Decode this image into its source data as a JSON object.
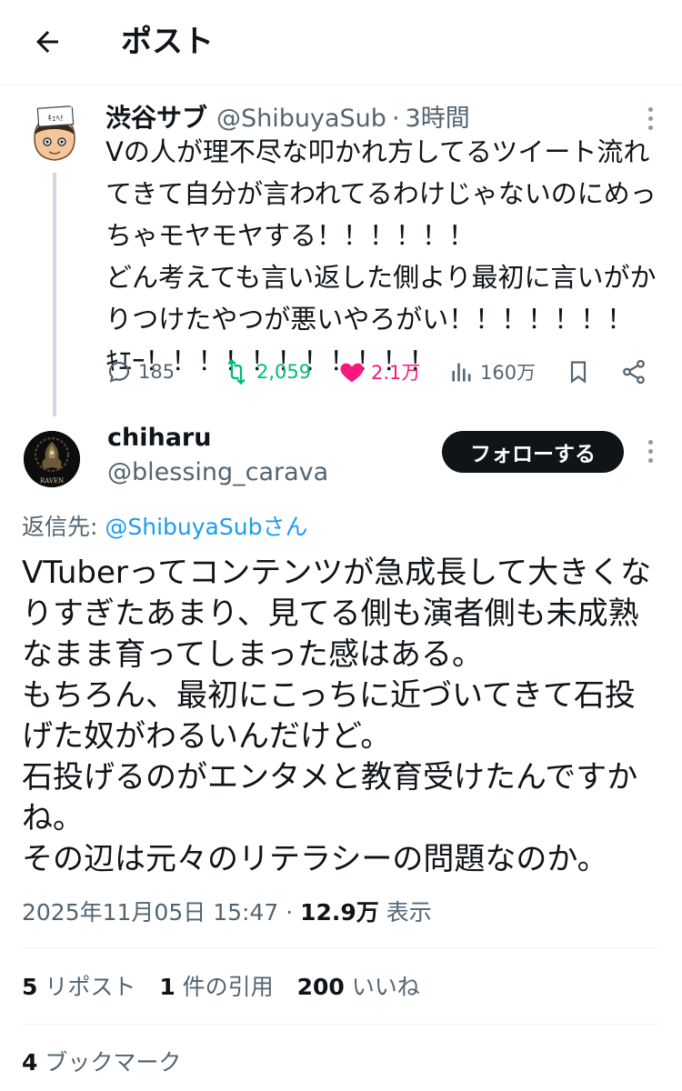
{
  "header": {
    "title": "ポスト",
    "back_icon": "arrow-left-icon"
  },
  "parent": {
    "avatar_text": "ｷｪﾍ!",
    "name": "渋谷サブ",
    "handle": "@ShibuyaSub",
    "separator": "·",
    "time": "3時間",
    "text_lines": [
      "Vの人が理不尽な叩かれ方してるツイート流れ",
      "てきて自分が言われてるわけじゃないのにめっ",
      "ちゃモヤモヤする！！！！！！",
      "どん考えても言い返した側より最初に言いがか",
      "りつけたやつが悪いやろがい！！！！！！！",
      "ｷｴｰ！！！！！！！！！！！"
    ],
    "actions": {
      "replies": "185",
      "reposts": "2,059",
      "likes": "2.1万",
      "views": "160万"
    }
  },
  "reply": {
    "avatar_text": "RAVEN",
    "name": "chiharu",
    "handle": "@blessing_carava",
    "follow_label": "フォローする",
    "reply_to_prefix": "返信先: ",
    "reply_to_mention": "@ShibuyaSubさん",
    "text_lines": [
      "VTuberってコンテンツが急成長して大きくな",
      "りすぎたあまり、見てる側も演者側も未成熟",
      "なまま育ってしまった感はある。",
      "もちろん、最初にこっちに近づいてきて石投",
      "げた奴がわるいんだけど。",
      "石投げるのがエンタメと教育受けたんですか",
      "ね。",
      "その辺は元々のリテラシーの問題なのか。"
    ],
    "timestamp": "2025年11月05日 15:47",
    "separator": " · ",
    "views_count": "12.9万",
    "views_label": " 表示",
    "stats": {
      "reposts_count": "5",
      "reposts_label": " リポスト",
      "quotes_count": "1",
      "quotes_label": " 件の引用",
      "likes_count": "200",
      "likes_label": " いいね",
      "bookmarks_count": "4",
      "bookmarks_label": " ブックマーク"
    }
  },
  "colors": {
    "text": "#0f1419",
    "secondary": "#536471",
    "link": "#1d9bf0",
    "repost": "#00ba7c",
    "like": "#f91880",
    "follow_bg": "#0f1419"
  }
}
